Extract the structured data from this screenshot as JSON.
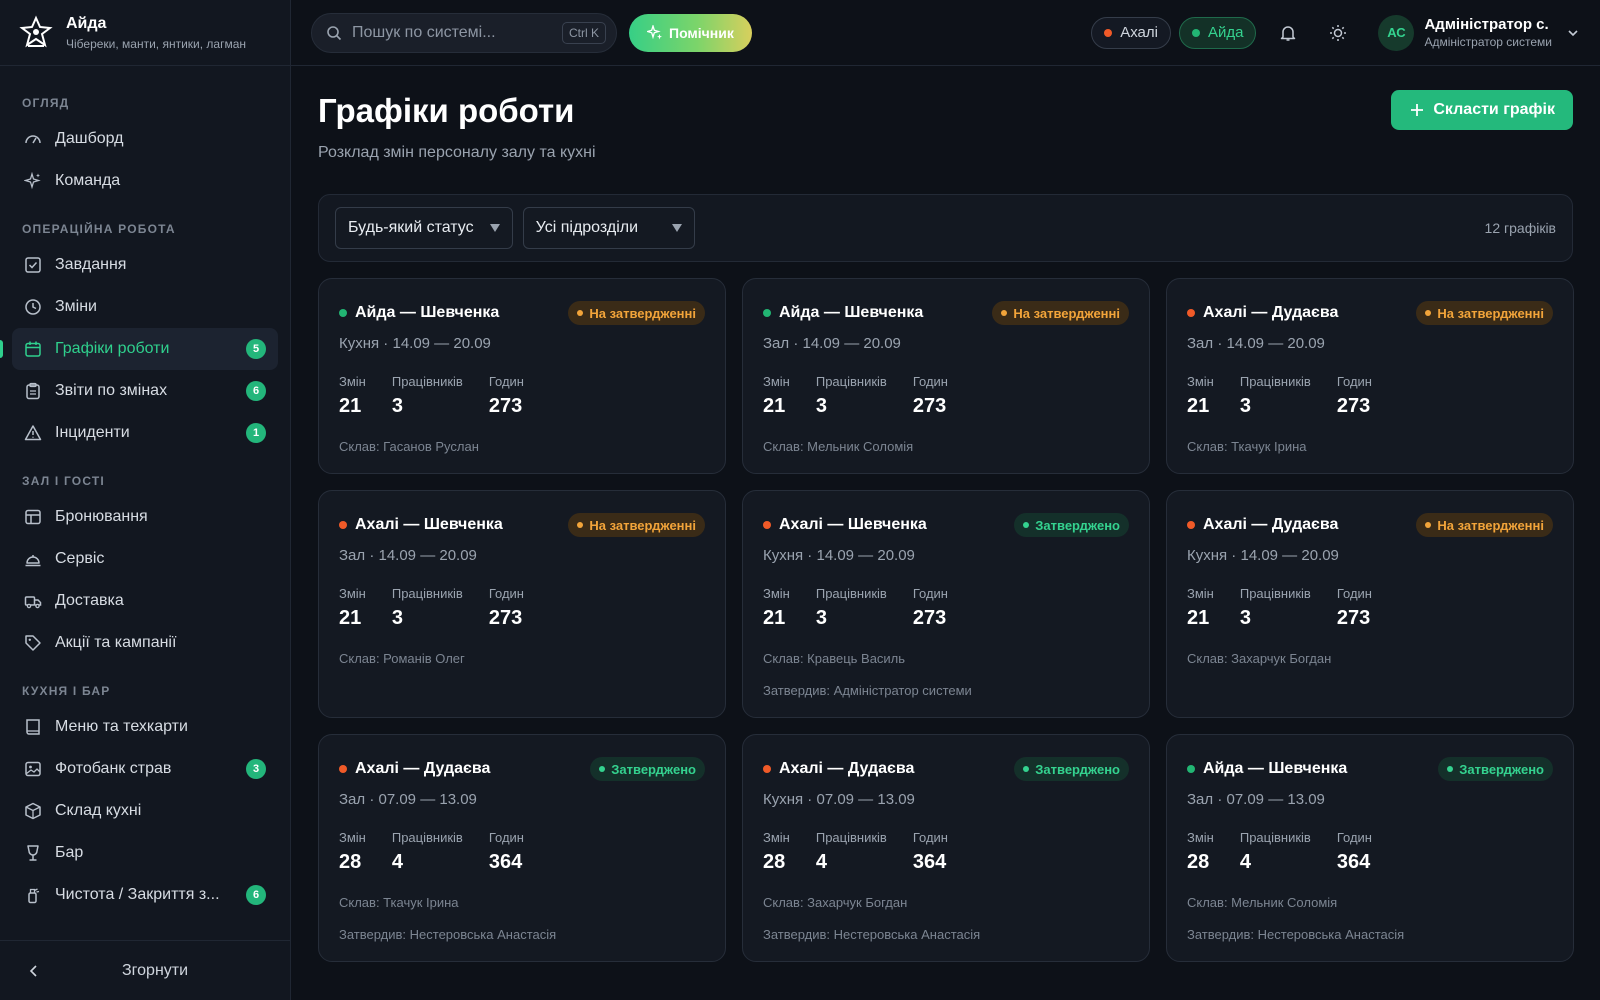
{
  "brand": {
    "name": "Айда",
    "subtitle": "Чібереки, манти, янтики, лагман"
  },
  "sidebar": {
    "sections": [
      {
        "title": "ОГЛЯД",
        "items": [
          {
            "label": "Дашборд",
            "icon": "gauge-icon"
          },
          {
            "label": "Команда",
            "icon": "sparkle-icon"
          }
        ]
      },
      {
        "title": "ОПЕРАЦІЙНА РОБОТА",
        "items": [
          {
            "label": "Завдання",
            "icon": "checkbox-icon"
          },
          {
            "label": "Зміни",
            "icon": "clock-icon"
          },
          {
            "label": "Графіки роботи",
            "icon": "calendar-icon",
            "badge": "5",
            "active": true
          },
          {
            "label": "Звіти по змінах",
            "icon": "clipboard-icon",
            "badge": "6"
          },
          {
            "label": "Інциденти",
            "icon": "warning-icon",
            "badge": "1"
          }
        ]
      },
      {
        "title": "ЗАЛ І ГОСТІ",
        "items": [
          {
            "label": "Бронювання",
            "icon": "table-icon"
          },
          {
            "label": "Сервіс",
            "icon": "bell-service-icon"
          },
          {
            "label": "Доставка",
            "icon": "truck-icon"
          },
          {
            "label": "Акції та кампанії",
            "icon": "tag-icon"
          }
        ]
      },
      {
        "title": "КУХНЯ І БАР",
        "items": [
          {
            "label": "Меню та техкарти",
            "icon": "book-icon"
          },
          {
            "label": "Фотобанк страв",
            "icon": "image-icon",
            "badge": "3"
          },
          {
            "label": "Склад кухні",
            "icon": "box-icon"
          },
          {
            "label": "Бар",
            "icon": "glass-icon"
          },
          {
            "label": "Чистота / Закриття з...",
            "icon": "spray-icon",
            "badge": "6"
          }
        ]
      }
    ],
    "collapse_label": "Згорнути"
  },
  "topbar": {
    "search_placeholder": "Пошук по системі...",
    "search_shortcut": "Ctrl K",
    "assistant_label": "Помічник",
    "locations": [
      {
        "label": "Ахалі",
        "dot_color": "#f05a28",
        "active": false
      },
      {
        "label": "Айда",
        "dot_color": "#22b573",
        "active": true
      }
    ],
    "user": {
      "initials": "АС",
      "name": "Адміністратор с.",
      "role": "Адміністратор системи"
    }
  },
  "page": {
    "title": "Графіки роботи",
    "subtitle": "Розклад змін персоналу залу та кухні",
    "create_label": "Скласти графік"
  },
  "filters": {
    "status": "Будь-який статус",
    "department": "Усі підрозділи",
    "count": "12 графіків"
  },
  "stat_labels": {
    "shifts": "Змін",
    "workers": "Працівників",
    "hours": "Годин"
  },
  "colors": {
    "aida": "#22b573",
    "ahali": "#f05a28",
    "pending": "#f2a43a",
    "approved": "#34d28f",
    "accent": "#24b97c"
  },
  "schedules": [
    {
      "title": "Айда — Шевченка",
      "dot": "aida",
      "status": "На затвердженні",
      "status_type": "pending",
      "meta": "Кухня · 14.09 — 20.09",
      "shifts": "21",
      "workers": "3",
      "hours": "273",
      "composed": "Склав: Гасанов Руслан",
      "approved_by": ""
    },
    {
      "title": "Айда — Шевченка",
      "dot": "aida",
      "status": "На затвердженні",
      "status_type": "pending",
      "meta": "Зал · 14.09 — 20.09",
      "shifts": "21",
      "workers": "3",
      "hours": "273",
      "composed": "Склав: Мельник Соломія",
      "approved_by": ""
    },
    {
      "title": "Ахалі — Дудаєва",
      "dot": "ahali",
      "status": "На затвердженні",
      "status_type": "pending",
      "meta": "Зал · 14.09 — 20.09",
      "shifts": "21",
      "workers": "3",
      "hours": "273",
      "composed": "Склав: Ткачук Ірина",
      "approved_by": ""
    },
    {
      "title": "Ахалі — Шевченка",
      "dot": "ahali",
      "status": "На затвердженні",
      "status_type": "pending",
      "meta": "Зал · 14.09 — 20.09",
      "shifts": "21",
      "workers": "3",
      "hours": "273",
      "composed": "Склав: Романів Олег",
      "approved_by": ""
    },
    {
      "title": "Ахалі — Шевченка",
      "dot": "ahali",
      "status": "Затверджено",
      "status_type": "approved",
      "meta": "Кухня · 14.09 — 20.09",
      "shifts": "21",
      "workers": "3",
      "hours": "273",
      "composed": "Склав: Кравець Василь",
      "approved_by": "Затвердив: Адміністратор системи"
    },
    {
      "title": "Ахалі — Дудаєва",
      "dot": "ahali",
      "status": "На затвердженні",
      "status_type": "pending",
      "meta": "Кухня · 14.09 — 20.09",
      "shifts": "21",
      "workers": "3",
      "hours": "273",
      "composed": "Склав: Захарчук Богдан",
      "approved_by": ""
    },
    {
      "title": "Ахалі — Дудаєва",
      "dot": "ahali",
      "status": "Затверджено",
      "status_type": "approved",
      "meta": "Зал · 07.09 — 13.09",
      "shifts": "28",
      "workers": "4",
      "hours": "364",
      "composed": "Склав: Ткачук Ірина",
      "approved_by": "Затвердив: Нестеровська Анастасія"
    },
    {
      "title": "Ахалі — Дудаєва",
      "dot": "ahali",
      "status": "Затверджено",
      "status_type": "approved",
      "meta": "Кухня · 07.09 — 13.09",
      "shifts": "28",
      "workers": "4",
      "hours": "364",
      "composed": "Склав: Захарчук Богдан",
      "approved_by": "Затвердив: Нестеровська Анастасія"
    },
    {
      "title": "Айда — Шевченка",
      "dot": "aida",
      "status": "Затверджено",
      "status_type": "approved",
      "meta": "Зал · 07.09 — 13.09",
      "shifts": "28",
      "workers": "4",
      "hours": "364",
      "composed": "Склав: Мельник Соломія",
      "approved_by": "Затвердив: Нестеровська Анастасія"
    }
  ]
}
